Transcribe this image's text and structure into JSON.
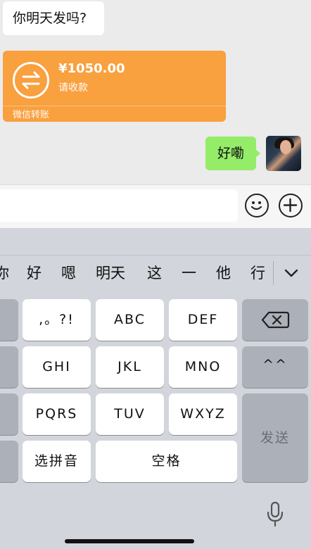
{
  "chat": {
    "incoming_message": "你明天发吗?",
    "transfer": {
      "amount": "¥1050.00",
      "status": "请收款",
      "footer": "微信转账",
      "color": "#f9a03f"
    },
    "outgoing_message": "好嘞",
    "outgoing_color": "#95ec69"
  },
  "input_bar": {
    "emoji_icon": "smiley-icon",
    "plus_icon": "plus-icon"
  },
  "keyboard": {
    "candidates": [
      "你",
      "好",
      "嗯",
      "明天",
      "这",
      "一",
      "他",
      "行"
    ],
    "expand_icon": "chevron-down-icon",
    "rows": [
      [
        ",。?!",
        "ABC",
        "DEF"
      ],
      [
        "GHI",
        "JKL",
        "MNO"
      ],
      [
        "PQRS",
        "TUV",
        "WXYZ"
      ]
    ],
    "backspace_icon": "backspace-icon",
    "tone_key": "^^",
    "send_label": "发送",
    "pinyin_label": "选拼音",
    "space_label": "空格",
    "mic_icon": "microphone-icon"
  }
}
